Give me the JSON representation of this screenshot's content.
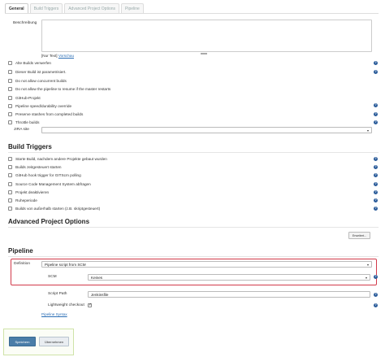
{
  "tabs": [
    "General",
    "Build Triggers",
    "Advanced Project Options",
    "Pipeline"
  ],
  "general": {
    "description_label": "Beschreibung",
    "description_value": "",
    "preview_prefix": "[Nur Text]",
    "preview_link": "Vorschau",
    "options": [
      {
        "label": "Alte Builds verwerfen",
        "checked": false,
        "help": true
      },
      {
        "label": "Dieser Build ist parametrisiert.",
        "checked": false,
        "help": true
      },
      {
        "label": "Do not allow concurrent builds",
        "checked": false,
        "help": false
      },
      {
        "label": "Do not allow the pipeline to resume if the master restarts",
        "checked": false,
        "help": false
      },
      {
        "label": "GitHub-Projekt",
        "checked": false,
        "help": false
      },
      {
        "label": "Pipeline speed/durability override",
        "checked": false,
        "help": true
      },
      {
        "label": "Preserve stashes from completed builds",
        "checked": false,
        "help": true
      },
      {
        "label": "Throttle builds",
        "checked": false,
        "help": true
      }
    ],
    "jira_label": "JIRA site",
    "jira_value": ""
  },
  "build_triggers": {
    "heading": "Build Triggers",
    "options": [
      {
        "label": "Starte Build, nachdem andere Projekte gebaut wurden",
        "help": true
      },
      {
        "label": "Builds zeitgesteuert starten",
        "help": true
      },
      {
        "label": "GitHub hook trigger for GITScm polling",
        "help": true
      },
      {
        "label": "Source Code Management System abfragen",
        "help": true
      },
      {
        "label": "Projekt deaktivieren",
        "help": true
      },
      {
        "label": "Ruheperiode",
        "help": true
      },
      {
        "label": "Builds von außerhalb starten (z.B. skriptgesteuert)",
        "help": true
      }
    ]
  },
  "advanced": {
    "heading": "Advanced Project Options",
    "button": "Erweitert..."
  },
  "pipeline": {
    "heading": "Pipeline",
    "definition_label": "Definition",
    "definition_value": "Pipeline script from SCM",
    "scm_label": "SCM",
    "scm_value": "Keines",
    "script_path_label": "Script Path",
    "script_path_value": "Jenkinsfile",
    "lightweight_label": "Lightweight checkout",
    "lightweight_checked": true,
    "syntax_link": "Pipeline Syntax"
  },
  "footer": {
    "save": "Speichern",
    "apply": "Übernehmen"
  },
  "colors": {
    "accent": "#4a7da8",
    "highlight": "#d23a4a",
    "help_icon": "#2b5c9a"
  }
}
